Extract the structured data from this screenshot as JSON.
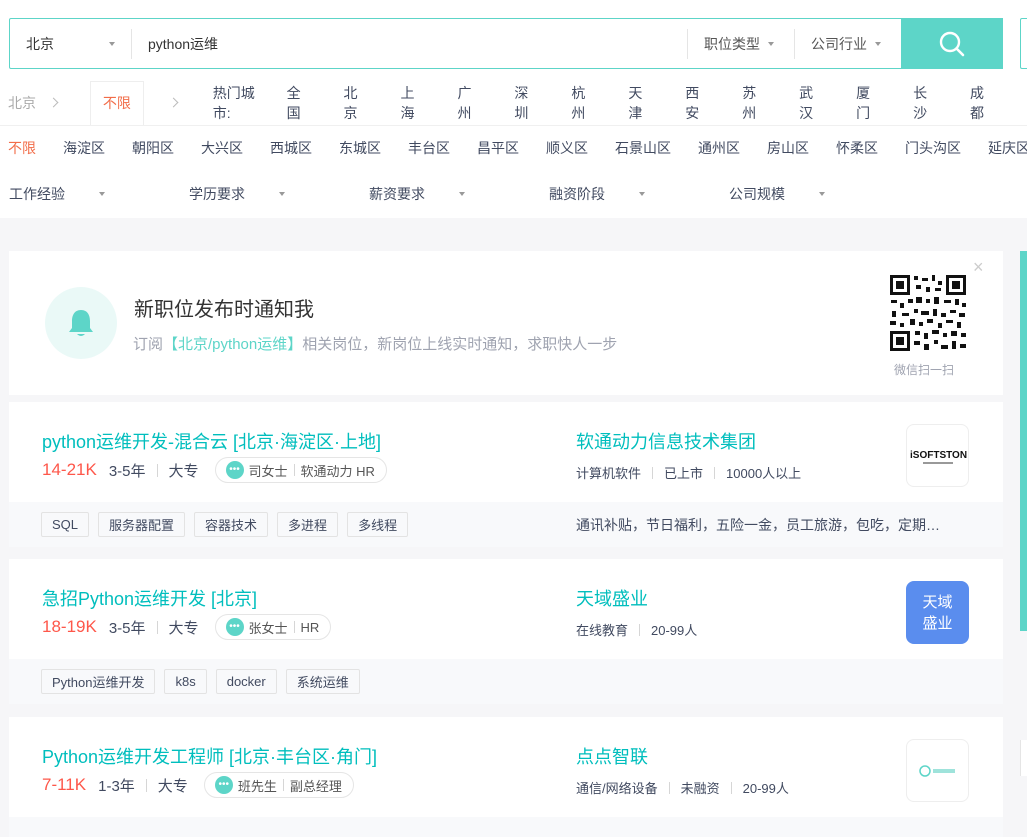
{
  "search": {
    "city": "北京",
    "keyword": "python运维",
    "job_type": "职位类型",
    "industry": "公司行业"
  },
  "city_row": {
    "current": "北京",
    "unlimited": "不限",
    "hot_label": "热门城市:",
    "cities": [
      "全国",
      "北京",
      "上海",
      "广州",
      "深圳",
      "杭州",
      "天津",
      "西安",
      "苏州",
      "武汉",
      "厦门",
      "长沙",
      "成都"
    ]
  },
  "district_row": {
    "active": "不限",
    "districts": [
      "海淀区",
      "朝阳区",
      "大兴区",
      "西城区",
      "东城区",
      "丰台区",
      "昌平区",
      "顺义区",
      "石景山区",
      "通州区",
      "房山区",
      "怀柔区",
      "门头沟区",
      "延庆区"
    ]
  },
  "filters": [
    "工作经验",
    "学历要求",
    "薪资要求",
    "融资阶段",
    "公司规模"
  ],
  "notify": {
    "title": "新职位发布时通知我",
    "sub_prefix": "订阅",
    "sub_highlight": "【北京/python运维】",
    "sub_suffix": "相关岗位，新岗位上线实时通知，求职快人一步",
    "qr_label": "微信扫一扫",
    "close": "×"
  },
  "jobs": [
    {
      "title": "python运维开发-混合云  [北京·海淀区·上地]",
      "salary": "14-21K",
      "experience": "3-5年",
      "education": "大专",
      "hr_name": "司女士",
      "hr_title": "软通动力 HR",
      "company": "软通动力信息技术集团",
      "company_tags": [
        "计算机软件",
        "已上市",
        "10000人以上"
      ],
      "logo_text": "iSOFTSTONE",
      "tags": [
        "SQL",
        "服务器配置",
        "容器技术",
        "多进程",
        "多线程"
      ],
      "benefits": "通讯补贴，节日福利，五险一金，员工旅游，包吃，定期…"
    },
    {
      "title": "急招Python运维开发  [北京]",
      "salary": "18-19K",
      "experience": "3-5年",
      "education": "大专",
      "hr_name": "张女士",
      "hr_title": "HR",
      "company": "天域盛业",
      "company_tags": [
        "在线教育",
        "20-99人"
      ],
      "logo_text_1": "天域",
      "logo_text_2": "盛业",
      "tags": [
        "Python运维开发",
        "k8s",
        "docker",
        "系统运维"
      ],
      "benefits": ""
    },
    {
      "title": "Python运维开发工程师  [北京·丰台区·角门]",
      "salary": "7-11K",
      "experience": "1-3年",
      "education": "大专",
      "hr_name": "班先生",
      "hr_title": "副总经理",
      "company": "点点智联",
      "company_tags": [
        "通信/网络设备",
        "未融资",
        "20-99人"
      ],
      "tags": [],
      "benefits": ""
    }
  ],
  "colors": {
    "accent": "#5dd5c8",
    "title_teal": "#00bebd",
    "salary_red": "#fe574a",
    "active_orange": "#f26d49"
  }
}
